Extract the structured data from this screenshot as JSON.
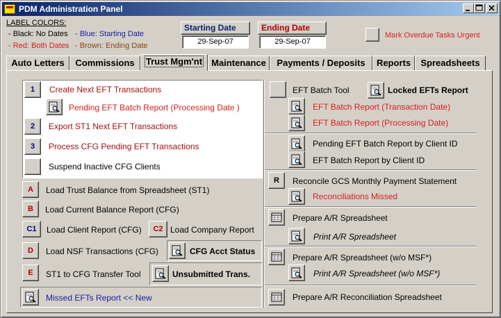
{
  "window": {
    "title": "PDM Administration Panel"
  },
  "legend": {
    "title": "LABEL COLORS:",
    "black": "- Black: No Dates",
    "red": "- Red: Both Dates",
    "blue": "- Blue: Starting Date",
    "brown": "- Brown: Ending Date"
  },
  "dates": {
    "starting_label": "Starting Date",
    "starting_value": "29-Sep-07",
    "ending_label": "Ending Date",
    "ending_value": "29-Sep-07"
  },
  "overdue": {
    "label": "Mark Overdue Tasks Urgent"
  },
  "tabs": [
    {
      "label": "Auto Letters"
    },
    {
      "label": "Commissions"
    },
    {
      "label": "Trust Mgm'nt"
    },
    {
      "label": "Maintenance"
    },
    {
      "label": "Payments / Deposits"
    },
    {
      "label": "Reports"
    },
    {
      "label": "Spreadsheets"
    }
  ],
  "left": {
    "b1": "1",
    "create_eft": "Create Next EFT Transactions",
    "pending_eft_report": "Pending EFT Batch Report (Processing Date )",
    "b2": "2",
    "export_st1": "Export ST1 Next EFT Transactions",
    "b3": "3",
    "process_cfg": "Process CFG Pending EFT Transactions",
    "suspend": "Suspend Inactive CFG Clients",
    "bA": "A",
    "load_trust": "Load Trust Balance from Spreadsheet (ST1)",
    "bB": "B",
    "load_current": "Load Current Balance Report (CFG)",
    "bC1": "C1",
    "load_client": "Load Client Report (CFG)",
    "bC2": "C2",
    "load_company": "Load Company Report",
    "bD": "D",
    "load_nsf": "Load NSF Transactions (CFG)",
    "cfg_acct_status": "CFG Acct Status",
    "bE": "E",
    "st1_cfg_transfer": "ST1 to CFG Transfer Tool",
    "unsubmitted": "Unsubmitted Trans.",
    "missed_efts": "Missed EFTs Report << New"
  },
  "right": {
    "eft_batch_tool": "EFT Batch Tool",
    "locked_efts": "Locked EFTs Report",
    "eft_batch_txn": "EFT Batch Report (Transaction Date)",
    "eft_batch_proc": "EFT Batch Report (Processing Date)",
    "pending_by_client": "Pending EFT Batch Report by Client ID",
    "eft_by_client": "EFT Batch Report by Client ID",
    "bR": "R",
    "reconcile_gcs": "Reconcile GCS Monthly Payment Statement",
    "recon_missed": "Reconciliations Missed",
    "prepare_ar": "Prepare A/R Spreadsheet",
    "print_ar": "Print A/R Spreadsheet",
    "prepare_ar_msf": "Prepare A/R Spreadsheet (w/o MSF*)",
    "print_ar_msf": "Print A/R Spreadsheet  (w/o MSF*)",
    "prepare_ar_recon": "Prepare A/R Reconciliation Spreadsheet"
  },
  "colors": {
    "dark_red": "#a01010",
    "bright_red": "#d81e1e",
    "dark_blue": "#1a1aa0",
    "title_bar": "#0a246a",
    "face": "#d4d0c8"
  }
}
